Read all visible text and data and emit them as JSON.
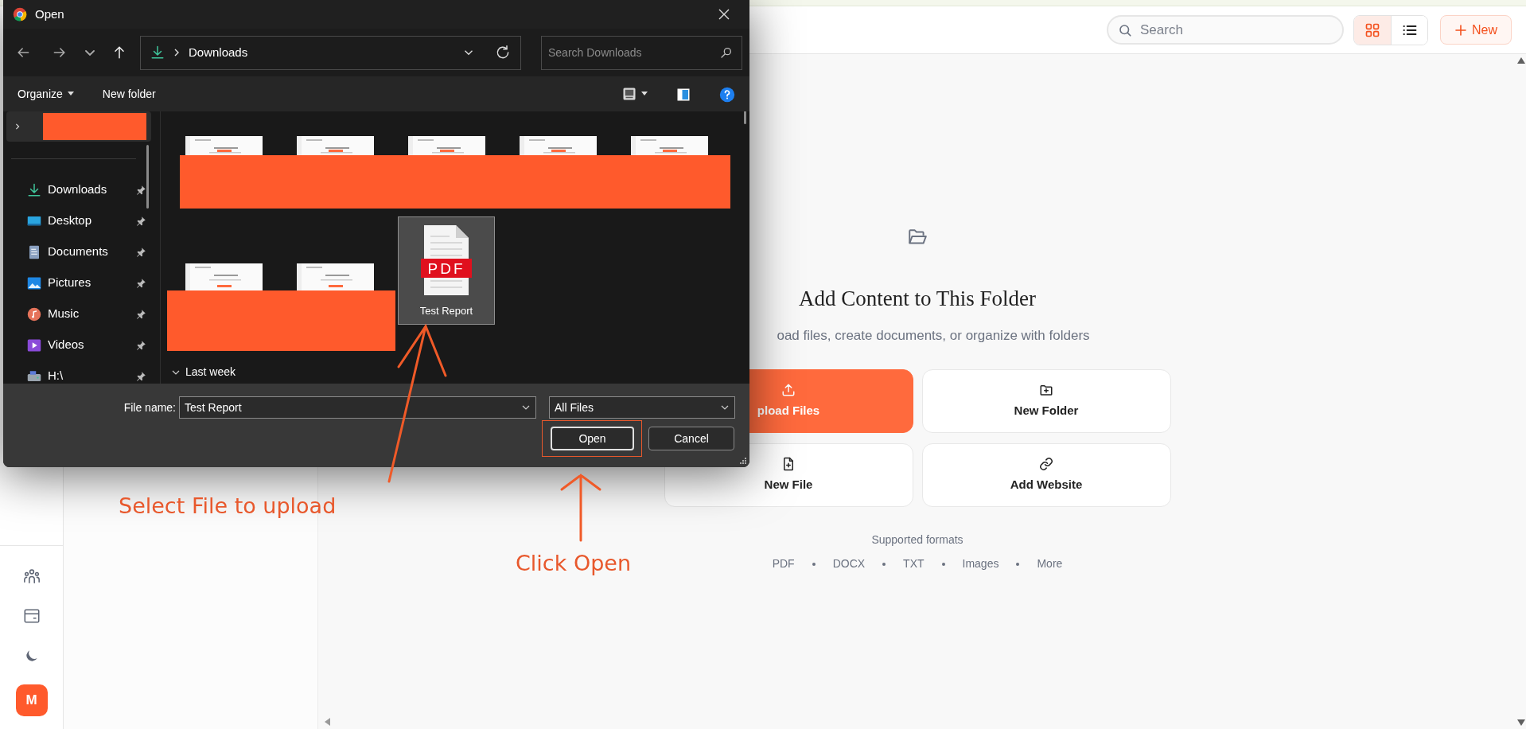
{
  "app": {
    "header": {
      "search": {
        "placeholder": "Search"
      },
      "view_toggle": [
        {
          "kind": "grid",
          "selected": true
        },
        {
          "kind": "list",
          "selected": false
        }
      ],
      "new_button": {
        "label": "New"
      }
    },
    "sidebar": {
      "items": [
        {
          "kind": "team"
        },
        {
          "kind": "billing"
        },
        {
          "kind": "theme"
        }
      ],
      "avatar": "M"
    },
    "empty_state": {
      "title": "Add Content to This Folder",
      "subtitle": "oad files, create documents, or organize with folders",
      "actions": [
        {
          "kind": "upload",
          "label": "pload Files",
          "primary": true
        },
        {
          "kind": "folder",
          "label": "New Folder",
          "primary": false
        },
        {
          "kind": "file",
          "label": "New File",
          "primary": false
        },
        {
          "kind": "link",
          "label": "Add Website",
          "primary": false
        }
      ],
      "formats_label": "Supported formats",
      "formats": [
        "PDF",
        "DOCX",
        "TXT",
        "Images",
        "More"
      ]
    }
  },
  "dialog": {
    "title": "Open",
    "address": "Downloads",
    "search": {
      "placeholder": "Search Downloads"
    },
    "toolbar": [
      {
        "kind": "menu",
        "label": "Organize"
      },
      {
        "kind": "button",
        "label": "New folder"
      }
    ],
    "nav_root": {
      "selected": true
    },
    "nav_items": [
      {
        "kind": "downloads",
        "label": "Downloads",
        "pinned": true
      },
      {
        "kind": "desktop",
        "label": "Desktop",
        "pinned": true
      },
      {
        "kind": "documents",
        "label": "Documents",
        "pinned": true
      },
      {
        "kind": "pictures",
        "label": "Pictures",
        "pinned": true
      },
      {
        "kind": "music",
        "label": "Music",
        "pinned": true
      },
      {
        "kind": "videos",
        "label": "Videos",
        "pinned": true
      },
      {
        "kind": "drive",
        "label": "H:\\",
        "pinned": true
      }
    ],
    "files": [
      {
        "kind": "thumbnail",
        "selected": false
      },
      {
        "kind": "thumbnail",
        "selected": false
      },
      {
        "kind": "thumbnail",
        "selected": false
      },
      {
        "kind": "thumbnail",
        "selected": false
      },
      {
        "kind": "thumbnail",
        "selected": false
      },
      {
        "kind": "thumbnail",
        "selected": false
      },
      {
        "kind": "thumbnail",
        "selected": false
      },
      {
        "kind": "pdf",
        "icon_text": "PDF",
        "label": "Test Report",
        "selected": true
      }
    ],
    "group": "Last week",
    "file_name_label": "File name:",
    "file_name": "Test Report",
    "file_type": "All Files",
    "buttons": [
      "Open",
      "Cancel"
    ]
  },
  "annotations": [
    {
      "text": "Select File to upload"
    },
    {
      "text": "Click Open"
    }
  ]
}
